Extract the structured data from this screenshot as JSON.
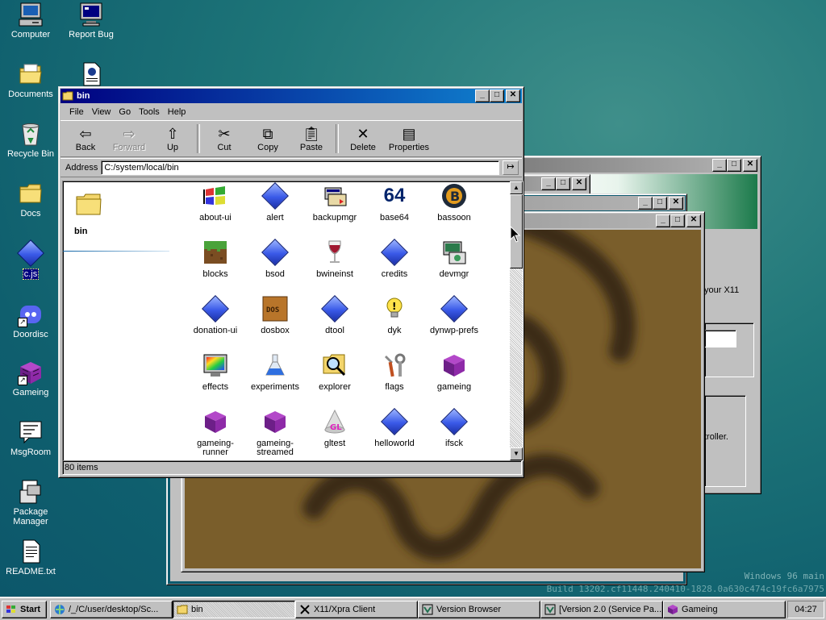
{
  "desktop": {
    "icons": [
      {
        "label": "Computer",
        "icon": "computer-icon"
      },
      {
        "label": "Report Bug",
        "icon": "monitor-icon"
      },
      {
        "label": "Documents",
        "icon": "folder-icon"
      },
      {
        "label": "",
        "icon": "document-icon"
      },
      {
        "label": "Recycle Bin",
        "icon": "recycle-bin-icon"
      },
      {
        "label": "Docs",
        "icon": "folder-icon"
      },
      {
        "label": "c.js",
        "icon": "diamond-icon"
      },
      {
        "label": "Doordisc",
        "icon": "discord-icon"
      },
      {
        "label": "Gameing",
        "icon": "cube-icon"
      },
      {
        "label": "MsgRoom",
        "icon": "chat-icon"
      },
      {
        "label": "Package Manager",
        "icon": "package-icon"
      },
      {
        "label": "README.txt",
        "icon": "text-file-icon"
      }
    ],
    "watermark_line1": "Windows 96 main",
    "watermark_line2": "Build 13202.cf11448.240410-1828.0a630c474c19fc6a7975"
  },
  "explorer": {
    "title": "bin",
    "menu": [
      "File",
      "View",
      "Go",
      "Tools",
      "Help"
    ],
    "toolbar": {
      "back": "Back",
      "forward": "Forward",
      "up": "Up",
      "cut": "Cut",
      "copy": "Copy",
      "paste": "Paste",
      "delete": "Delete",
      "properties": "Properties"
    },
    "address_label": "Address",
    "address_value": "C:/system/local/bin",
    "folder_name": "bin",
    "status": "80 items",
    "files": [
      {
        "name": "about-ui",
        "icon": "windows-flag-icon"
      },
      {
        "name": "alert",
        "icon": "diamond-icon"
      },
      {
        "name": "backupmgr",
        "icon": "backup-icon"
      },
      {
        "name": "base64",
        "icon": "base64-icon",
        "glyph": "64"
      },
      {
        "name": "bassoon",
        "icon": "bassoon-icon",
        "glyph": "B"
      },
      {
        "name": "blocks",
        "icon": "grass-block-icon"
      },
      {
        "name": "bsod",
        "icon": "diamond-icon"
      },
      {
        "name": "bwineinst",
        "icon": "wine-glass-icon"
      },
      {
        "name": "credits",
        "icon": "diamond-icon"
      },
      {
        "name": "devmgr",
        "icon": "device-manager-icon"
      },
      {
        "name": "donation-ui",
        "icon": "diamond-icon"
      },
      {
        "name": "dosbox",
        "icon": "dosbox-icon",
        "glyph": "DOS"
      },
      {
        "name": "dtool",
        "icon": "diamond-icon"
      },
      {
        "name": "dyk",
        "icon": "lightbulb-icon"
      },
      {
        "name": "dynwp-prefs",
        "icon": "diamond-icon"
      },
      {
        "name": "effects",
        "icon": "effects-monitor-icon"
      },
      {
        "name": "experiments",
        "icon": "flask-icon"
      },
      {
        "name": "explorer",
        "icon": "magnifier-icon"
      },
      {
        "name": "flags",
        "icon": "tools-icon"
      },
      {
        "name": "gameing",
        "icon": "cube-icon"
      },
      {
        "name": "gameing-runner",
        "icon": "cube-icon"
      },
      {
        "name": "gameing-streamed",
        "icon": "cube-icon"
      },
      {
        "name": "gltest",
        "icon": "gl-cone-icon",
        "glyph": "GL"
      },
      {
        "name": "helloworld",
        "icon": "diamond-icon"
      },
      {
        "name": "ifsck",
        "icon": "diamond-icon"
      }
    ]
  },
  "bg_windows": {
    "xpra_text1": "your X11",
    "xpra_text2": "troller."
  },
  "taskbar": {
    "start": "Start",
    "items": [
      {
        "label": "/_/C/user/desktop/Sc...",
        "icon": "explorer-icon"
      },
      {
        "label": "bin",
        "icon": "folder-icon"
      },
      {
        "label": "X11/Xpra Client",
        "icon": "x11-icon"
      },
      {
        "label": "Version Browser",
        "icon": "version-icon"
      },
      {
        "label": "[Version 2.0 (Service Pa...",
        "icon": "version-icon"
      },
      {
        "label": "Gameing",
        "icon": "cube-icon"
      }
    ],
    "clock": "04:27"
  }
}
